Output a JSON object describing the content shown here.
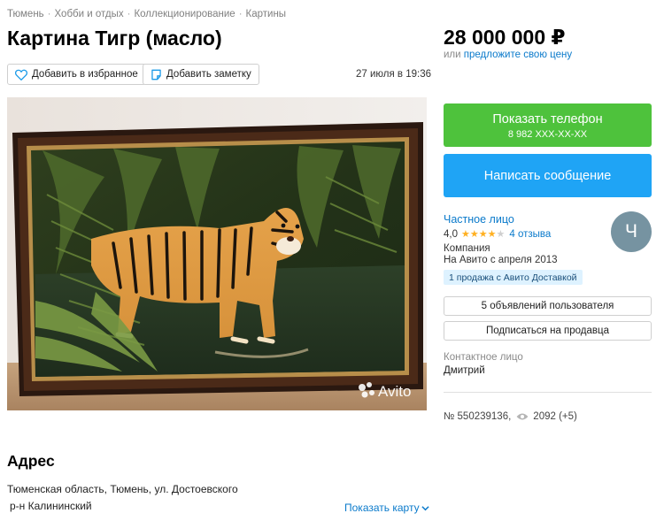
{
  "breadcrumb": [
    "Тюмень",
    "Хобби и отдых",
    "Коллекционирование",
    "Картины"
  ],
  "title": "Картина Тигр (масло)",
  "actions": {
    "favorite_label": "Добавить в избранное",
    "note_label": "Добавить заметку"
  },
  "posted_date": "27 июля в 19:36",
  "photo": {
    "watermark": "Avito"
  },
  "price": {
    "amount": "28 000 000 ₽",
    "or_text": "или",
    "offer_link": "предложите свою цену"
  },
  "contact": {
    "show_phone_label": "Показать телефон",
    "phone_masked": "8 982 XXX-XX-XX",
    "write_message_label": "Написать сообщение"
  },
  "seller": {
    "name": "Частное лицо",
    "rating": "4,0",
    "rating_value": 4,
    "rating_max": 5,
    "reviews": "4 отзыва",
    "type": "Компания",
    "since": "На Авито с апреля 2013",
    "delivery_badge": "1 продажа с Авито Доставкой",
    "avatar_letter": "Ч",
    "listings_label": "5 объявлений пользователя",
    "subscribe_label": "Подписаться на продавца"
  },
  "contact_person": {
    "label": "Контактное лицо",
    "name": "Дмитрий"
  },
  "ad": {
    "number": "№ 550239136,",
    "views": "2092 (+5)"
  },
  "address": {
    "heading": "Адрес",
    "line": "Тюменская область, Тюмень, ул. Достоевского",
    "district": "р-н Калининский",
    "show_map_label": "Показать карту"
  },
  "colors": {
    "green_button": "#4ec23c",
    "blue_button": "#1fa4f5",
    "link": "#0a7acb",
    "star": "#ffb021",
    "avatar": "#7693a1"
  }
}
